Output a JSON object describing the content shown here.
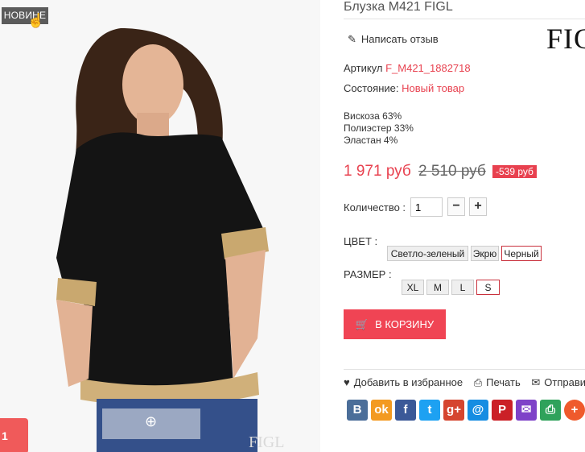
{
  "photo": {
    "badge": "НОВИНЕ",
    "watermark": "FIGL",
    "promo_text": "1"
  },
  "product": {
    "title": "Блузка M421 FIGL",
    "review_link": "Написать отзыв",
    "brand_logo": "FIGL",
    "article_label": "Артикул",
    "article_value": "F_M421_1882718",
    "condition_label": "Состояние:",
    "condition_value": "Новый товар",
    "composition": [
      "Вискоза 63%",
      "Полиэстер 33%",
      "Эластан 4%"
    ],
    "price_new": "1 971 руб",
    "price_old": "2 510 руб",
    "discount": "-539 руб",
    "quantity_label": "Количество :",
    "quantity_value": "1",
    "minus": "−",
    "plus": "+",
    "color_label": "ЦВЕТ :",
    "colors": [
      "Светло-зеленый",
      "Экрю",
      "Черный"
    ],
    "selected_color": "Черный",
    "size_label": "РАЗМЕР :",
    "sizes": [
      "XL",
      "M",
      "L",
      "S"
    ],
    "selected_size": "S",
    "cart_button": "В КОРЗИНУ"
  },
  "actions": {
    "favorite": "Добавить в избранное",
    "print": "Печать",
    "send": "Отправи"
  },
  "share": [
    {
      "icon": "vk-icon",
      "glyph": "В",
      "color": "#4b6e99"
    },
    {
      "icon": "odnoklassniki-icon",
      "glyph": "ok",
      "color": "#f39a21"
    },
    {
      "icon": "facebook-icon",
      "glyph": "f",
      "color": "#3b5998"
    },
    {
      "icon": "twitter-icon",
      "glyph": "t",
      "color": "#1da1f2"
    },
    {
      "icon": "google-plus-icon",
      "glyph": "g+",
      "color": "#d5452f"
    },
    {
      "icon": "mailru-icon",
      "glyph": "@",
      "color": "#168de2"
    },
    {
      "icon": "pinterest-icon",
      "glyph": "P",
      "color": "#cb2027"
    },
    {
      "icon": "email-icon",
      "glyph": "✉",
      "color": "#7e42c8"
    },
    {
      "icon": "print-icon",
      "glyph": "⎙",
      "color": "#2fa25b"
    },
    {
      "icon": "more-icon",
      "glyph": "+",
      "color": "#ef5a2c"
    }
  ]
}
